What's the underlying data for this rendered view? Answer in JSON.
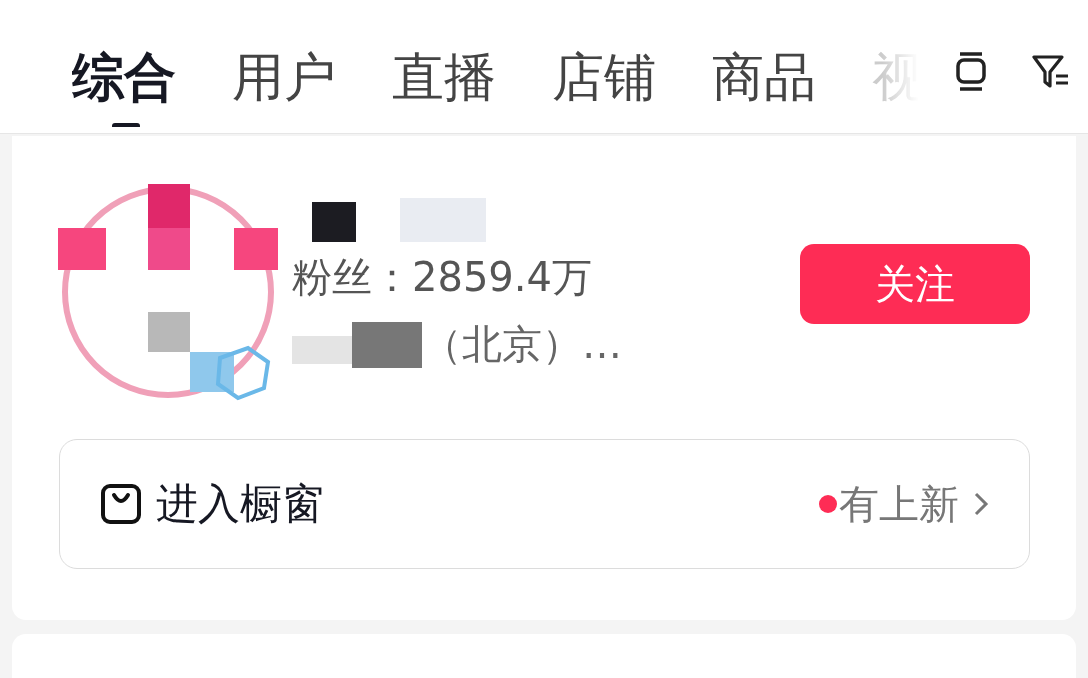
{
  "tabs": [
    {
      "label": "综合",
      "selected": true
    },
    {
      "label": "用户",
      "selected": false
    },
    {
      "label": "直播",
      "selected": false
    },
    {
      "label": "店铺",
      "selected": false
    },
    {
      "label": "商品",
      "selected": false
    },
    {
      "label": "视",
      "selected": false
    }
  ],
  "result": {
    "fans": "粉丝：2859.4万",
    "description": "（北京）…",
    "follow_button": "关注"
  },
  "store": {
    "label": "进入橱窗",
    "badge": "有上新",
    "has_new": true
  }
}
